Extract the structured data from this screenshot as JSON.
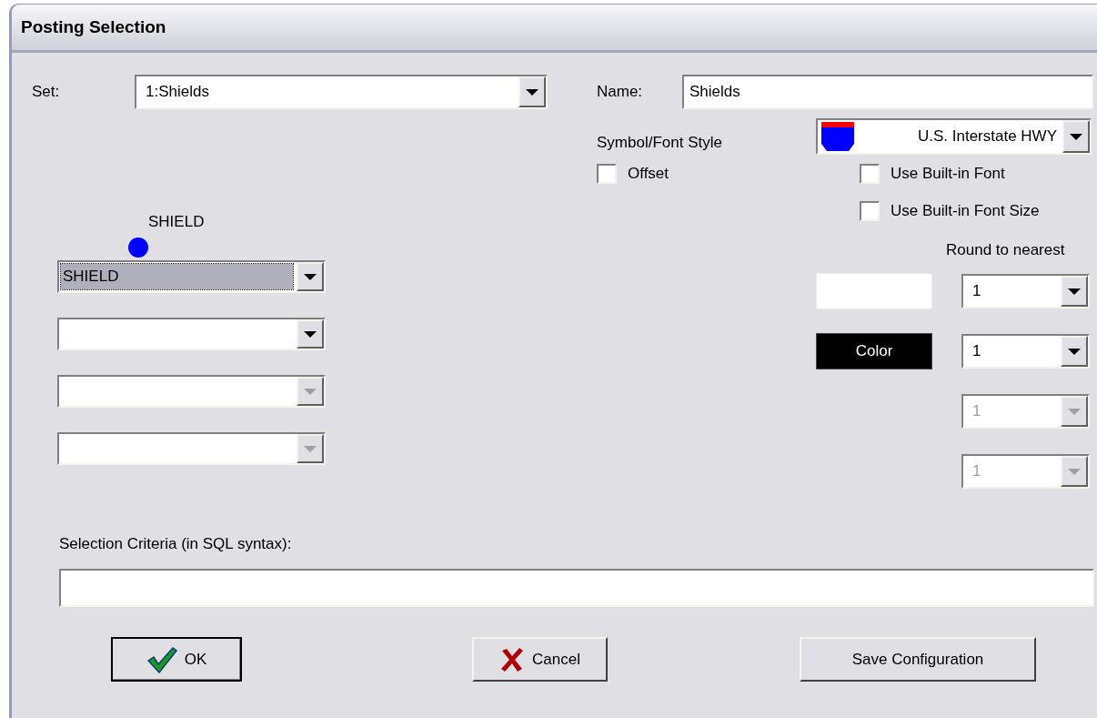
{
  "window": {
    "title": "Posting Selection"
  },
  "set": {
    "label": "Set:",
    "value": "1:Shields"
  },
  "name": {
    "label": "Name:",
    "value": "Shields"
  },
  "symbol_font_style": {
    "label": "Symbol/Font Style",
    "value": "U.S. Interstate HWY"
  },
  "checkboxes": [
    {
      "label": "Offset",
      "checked": false
    },
    {
      "label": "Use Built-in Font",
      "checked": false
    },
    {
      "label": "Use Built-in Font Size",
      "checked": false
    }
  ],
  "preview": {
    "label": "SHIELD"
  },
  "field_combos": [
    {
      "value": "SHIELD",
      "selected": true,
      "disabled": false
    },
    {
      "selected": false,
      "disabled": false
    },
    {
      "selected": false,
      "disabled": true
    },
    {
      "selected": false,
      "disabled": true
    }
  ],
  "round_to_nearest": {
    "label": "Round to nearest"
  },
  "rows": [
    {
      "swatch": {
        "kind": "blank"
      },
      "combo": {
        "value": "1",
        "disabled": false
      }
    },
    {
      "swatch": {
        "kind": "color",
        "label": "Color"
      },
      "combo": {
        "value": "1",
        "disabled": false
      }
    },
    {
      "combo": {
        "value": "1",
        "disabled": true
      }
    },
    {
      "combo": {
        "value": "1",
        "disabled": true
      }
    }
  ],
  "criteria": {
    "label": "Selection Criteria (in SQL syntax):"
  },
  "buttons": [
    {
      "label": "OK",
      "kind": "ok"
    },
    {
      "label": "Cancel",
      "kind": "cancel"
    },
    {
      "label": "Save Configuration",
      "kind": "plain"
    }
  ]
}
